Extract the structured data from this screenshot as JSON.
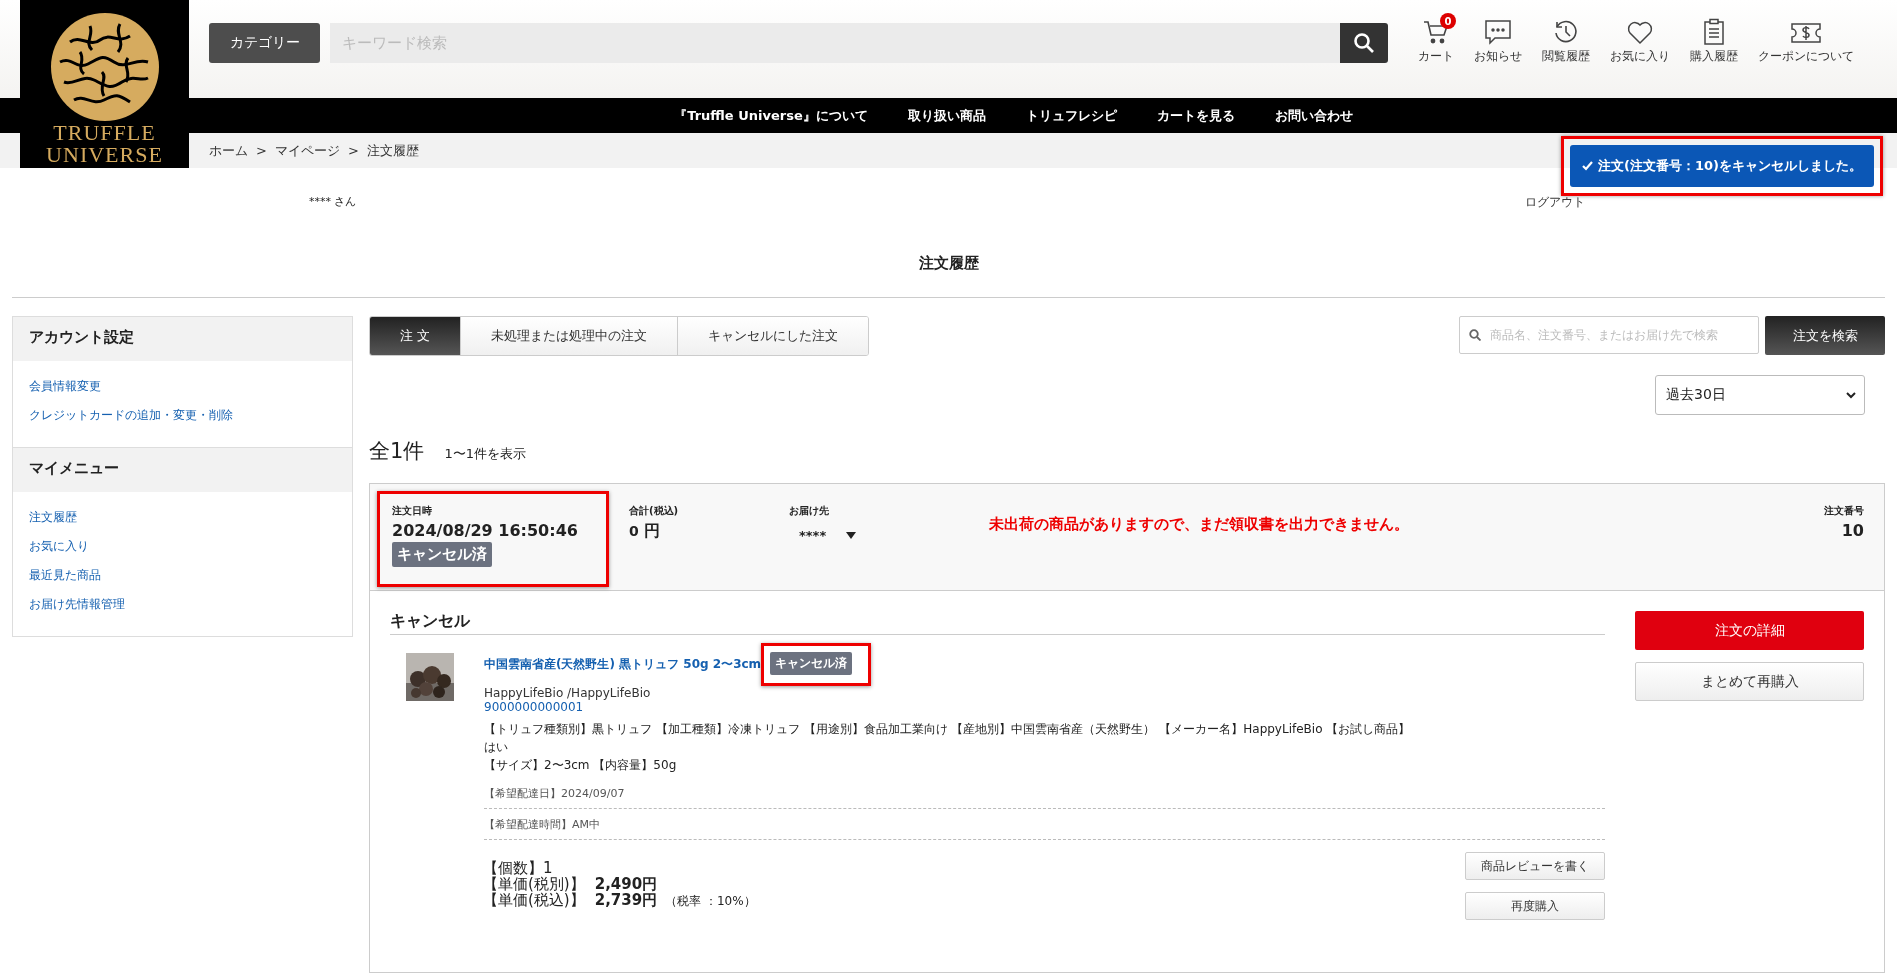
{
  "header": {
    "logo_lines": [
      "TRUFFLE",
      "UNIVERSE"
    ],
    "category_button": "カテゴリー",
    "search": {
      "placeholder": "キーワード検索"
    },
    "icons": [
      {
        "kind": "cart",
        "label": "カート",
        "badge": "0"
      },
      {
        "kind": "chat",
        "label": "お知らせ"
      },
      {
        "kind": "history",
        "label": "閲覧履歴"
      },
      {
        "kind": "heart",
        "label": "お気に入り"
      },
      {
        "kind": "clipboard",
        "label": "購入履歴"
      },
      {
        "kind": "coupon",
        "label": "クーポンについて"
      }
    ]
  },
  "nav": [
    "『Truffle Universe』について",
    "取り扱い商品",
    "トリュフレシピ",
    "カートを見る",
    "お問い合わせ"
  ],
  "breadcrumb": {
    "separator": ">",
    "items": [
      "ホーム",
      "マイページ",
      "注文履歴"
    ]
  },
  "toast": {
    "text": "注文(注文番号：10)をキャンセルしました。",
    "highlighted": true
  },
  "user": {
    "greeting": "****  さん",
    "logout": "ログアウト"
  },
  "page_title": "注文履歴",
  "sidebar": [
    {
      "title": "アカウント設定",
      "links": [
        "会員情報変更",
        "クレジットカードの追加・変更・削除"
      ]
    },
    {
      "title": "マイメニュー",
      "links": [
        "注文履歴",
        "お気に入り",
        "最近見た商品",
        "お届け先情報管理"
      ]
    }
  ],
  "tabs": [
    {
      "label": "注 文",
      "selected": true
    },
    {
      "label": "未処理または処理中の注文",
      "selected": false
    },
    {
      "label": "キャンセルにした注文",
      "selected": false
    }
  ],
  "order_search": {
    "placeholder": "商品名、注文番号、またはお届け先で検索",
    "button": "注文を検索"
  },
  "period": {
    "value": "過去30日"
  },
  "summary": {
    "count": "全1件",
    "range": "1〜1件を表示"
  },
  "orders": [
    {
      "date_label": "注文日時",
      "date": "2024/08/29 16:50:46",
      "status": "キャンセル済",
      "highlighted": true,
      "total_label": "合計(税込)",
      "total": "0",
      "currency": "円",
      "ship_label": "お届け先",
      "ship_to": "****",
      "notice": "未出荷の商品がありますので、まだ領収書を出力できません。",
      "number_label": "注文番号",
      "number": "10",
      "section_title": "キャンセル",
      "buttons": [
        "注文の詳細",
        "まとめて再購入"
      ],
      "items": [
        {
          "name": "中国雲南省産(天然野生) 黒トリュフ 50g 2〜3cm",
          "status": "キャンセル済",
          "highlighted": true,
          "seller": "HappyLifeBio /HappyLifeBio",
          "code": "9000000000001",
          "specs": [
            "【トリュフ種類別】黒トリュフ 【加工種類】冷凍トリュフ 【用途別】食品加工業向け 【産地別】中国雲南省産（天然野生） 【メーカー名】HappyLifeBio 【お試し商品】",
            "はい",
            "【サイズ】2〜3cm 【内容量】50g"
          ],
          "delivery": [
            "【希望配達日】2024/09/07",
            "【希望配達時間】AM中"
          ],
          "quantity": "【個数】1",
          "prices": [
            {
              "label": "【単価(税別)】",
              "value": "2,490円"
            },
            {
              "label": "【単価(税込)】",
              "value": "2,739円",
              "note": "（税率 ：10%）"
            }
          ],
          "buttons": [
            "商品レビューを書く",
            "再度購入"
          ]
        }
      ]
    }
  ]
}
